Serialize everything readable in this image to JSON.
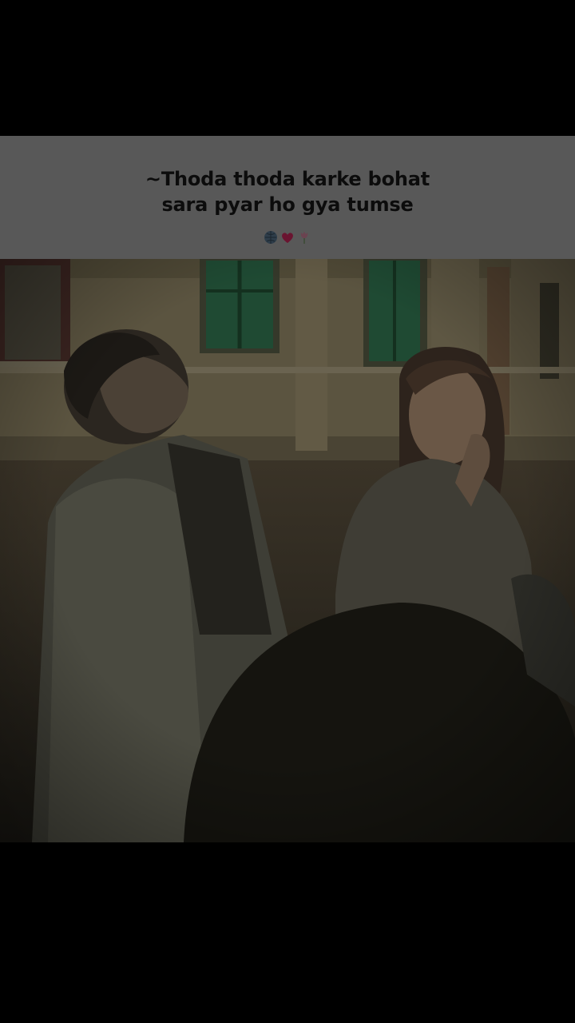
{
  "caption": {
    "line1": "~Thoda thoda karke bohat",
    "line2": "sara pyar ho gya tumse"
  },
  "emojis": [
    "globe-icon",
    "heart-icon",
    "tulip-icon"
  ],
  "colors": {
    "background": "#000000",
    "caption_panel": "#585858",
    "caption_text": "#0c0c0c"
  }
}
